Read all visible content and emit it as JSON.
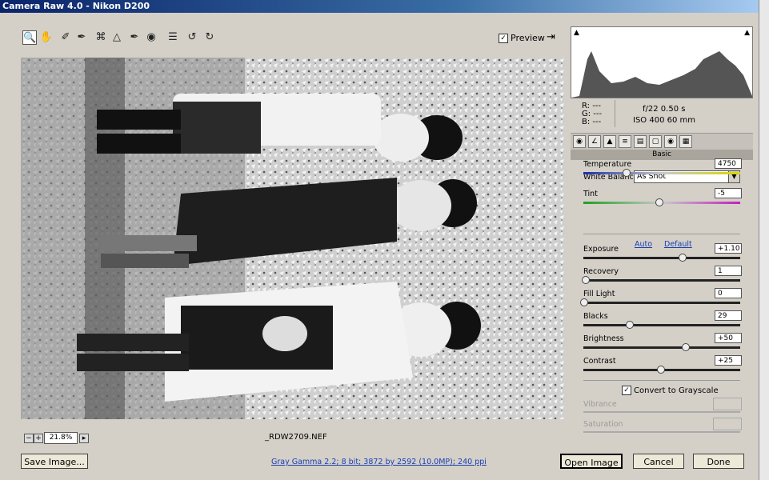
{
  "window": {
    "title": "Camera Raw 4.0  -  Nikon D200"
  },
  "toolbar": {
    "icons": [
      "zoom-icon",
      "hand-icon",
      "white-balance-icon",
      "color-sampler-icon",
      "crop-icon",
      "straighten-icon",
      "retouch-icon",
      "red-eye-icon",
      "preferences-icon",
      "rotate-left-icon",
      "rotate-right-icon"
    ],
    "preview_label": "Preview",
    "preview_checked": true
  },
  "status": {
    "zoom": "21.8%",
    "filename": "_RDW2709.NEF"
  },
  "info": {
    "r": "R:  ---",
    "g": "G:  ---",
    "b": "B:  ---",
    "exposure": "f/22   0.50 s",
    "iso_lens": "ISO 400   60 mm"
  },
  "panel": {
    "title": "Basic"
  },
  "basic": {
    "white_balance_label": "White Balance:",
    "white_balance_value": "As Shot",
    "auto": "Auto",
    "default": "Default",
    "convert_label": "Convert to Grayscale",
    "convert_checked": true,
    "sliders": [
      {
        "label": "Temperature",
        "value": "4750",
        "pos": 0.27
      },
      {
        "label": "Tint",
        "value": "-5",
        "pos": 0.48
      },
      {
        "label": "Exposure",
        "value": "+1.10",
        "pos": 0.63
      },
      {
        "label": "Recovery",
        "value": "1",
        "pos": 0.01
      },
      {
        "label": "Fill Light",
        "value": "0",
        "pos": 0.0
      },
      {
        "label": "Blacks",
        "value": "29",
        "pos": 0.29
      },
      {
        "label": "Brightness",
        "value": "+50",
        "pos": 0.65
      },
      {
        "label": "Contrast",
        "value": "+25",
        "pos": 0.49
      }
    ],
    "vibrance_label": "Vibrance",
    "saturation_label": "Saturation"
  },
  "footer": {
    "save": "Save Image...",
    "info_link": "Gray Gamma 2.2; 8 bit; 3872 by 2592 (10.0MP); 240 ppi",
    "open": "Open Image",
    "cancel": "Cancel",
    "done": "Done"
  },
  "colors": {
    "title_start": "#0a246a",
    "title_end": "#a6caf0",
    "link": "#1a3fb3"
  }
}
